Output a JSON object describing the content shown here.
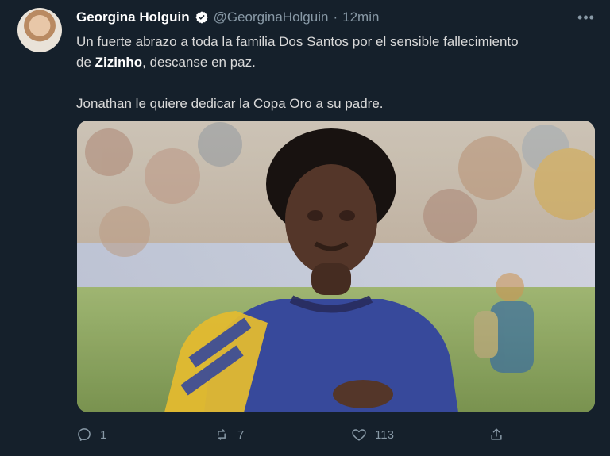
{
  "tweet": {
    "author_name": "Georgina Holguin",
    "handle": "@GeorginaHolguin",
    "separator": "·",
    "time": "12min",
    "more_label": "•••",
    "text": {
      "line1_prefix": "Un fuerte abrazo a toda la familia Dos Santos por el sensible fallecimiento",
      "line2_prefix": "de ",
      "line2_bold": "Zizinho",
      "line2_suffix": ", descanse en paz.",
      "paragraph2": "Jonathan le quiere dedicar la Copa Oro a su padre."
    },
    "actions": {
      "replies": "1",
      "retweets": "7",
      "likes": "113"
    }
  },
  "colors": {
    "background": "#15202b",
    "text": "#d9d9d9",
    "secondary": "#8899a6",
    "verified": "#ffffff"
  },
  "icons": {
    "verified": "verified-badge-icon",
    "more": "more-icon",
    "reply": "reply-icon",
    "retweet": "retweet-icon",
    "like": "heart-icon",
    "share": "share-icon"
  }
}
